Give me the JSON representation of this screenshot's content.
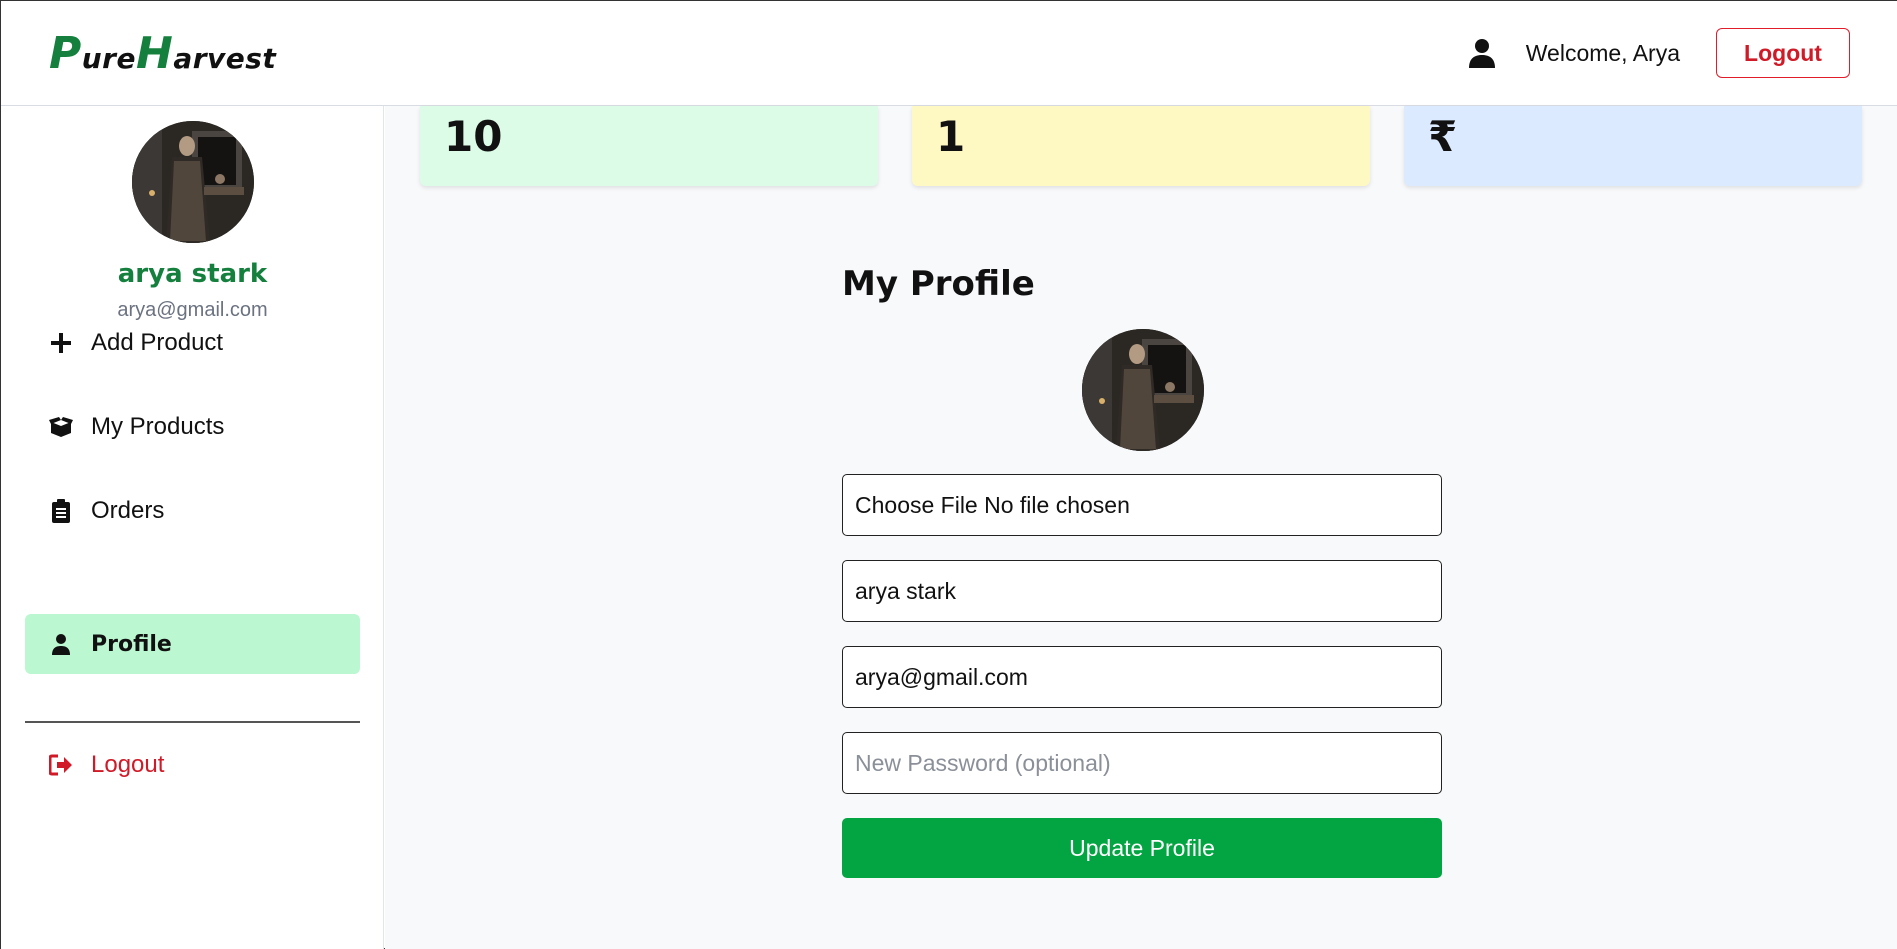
{
  "header": {
    "logo": {
      "p_cap": "P",
      "p_rest": "ure",
      "h_cap": "H",
      "h_rest": "arvest"
    },
    "user_icon": "user-icon",
    "welcome_text": "Welcome, Arya",
    "logout_label": "Logout",
    "colors": {
      "logo_accent": "#15803d",
      "logout": "#d11a28"
    }
  },
  "sidebar": {
    "name": "arya stark",
    "email": "arya@gmail.com",
    "items": [
      {
        "label": "Add Product",
        "icon": "plus-icon",
        "active": false
      },
      {
        "label": "My Products",
        "icon": "box-icon",
        "active": false
      },
      {
        "label": "Orders",
        "icon": "clipboard-icon",
        "active": false
      },
      {
        "label": "Profile",
        "icon": "user-icon",
        "active": true
      }
    ],
    "logout": {
      "label": "Logout",
      "icon": "sign-out-icon"
    },
    "colors": {
      "active_bg": "#bbf7d0",
      "name": "#15803d"
    }
  },
  "stats": [
    {
      "value": "10",
      "color": "#dcfce7"
    },
    {
      "value": "1",
      "color": "#fef9c3"
    },
    {
      "value": "₹",
      "color": "#dbeafe"
    }
  ],
  "profile": {
    "title": "My Profile",
    "file_input": {
      "button": "Choose File",
      "status": "No file chosen"
    },
    "name_value": "arya stark",
    "email_value": "arya@gmail.com",
    "password_placeholder": "New Password (optional)",
    "update_label": "Update Profile",
    "colors": {
      "update_button": "#02a541"
    }
  }
}
